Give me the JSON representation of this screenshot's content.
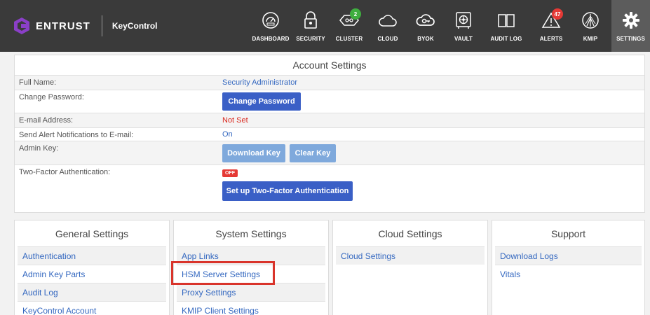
{
  "app": {
    "brand": "ENTRUST",
    "product": "KeyControl"
  },
  "nav": [
    {
      "label": "DASHBOARD",
      "icon": "dashboard-icon"
    },
    {
      "label": "SECURITY",
      "icon": "lock-icon"
    },
    {
      "label": "CLUSTER",
      "icon": "cluster-icon",
      "badge": "2"
    },
    {
      "label": "CLOUD",
      "icon": "cloud-icon"
    },
    {
      "label": "BYOK",
      "icon": "cloud-key-icon"
    },
    {
      "label": "VAULT",
      "icon": "vault-icon"
    },
    {
      "label": "AUDIT LOG",
      "icon": "book-icon"
    },
    {
      "label": "ALERTS",
      "icon": "warning-icon",
      "badge": "47"
    },
    {
      "label": "KMIP",
      "icon": "kmip-icon"
    },
    {
      "label": "SETTINGS",
      "icon": "gear-icon",
      "active": true
    }
  ],
  "account": {
    "title": "Account Settings",
    "full_name_label": "Full Name:",
    "full_name_value": "Security Administrator",
    "change_password_label": "Change Password:",
    "change_password_button": "Change Password",
    "email_label": "E-mail Address:",
    "email_value": "Not Set",
    "alert_label": "Send Alert Notifications to E-mail:",
    "alert_value": "On",
    "admin_key_label": "Admin Key:",
    "download_key_button": "Download Key",
    "clear_key_button": "Clear Key",
    "twofa_label": "Two-Factor Authentication:",
    "twofa_status": "OFF",
    "twofa_button": "Set up Two-Factor Authentication"
  },
  "panels": {
    "general": {
      "title": "General Settings",
      "links": [
        "Authentication",
        "Admin Key Parts",
        "Audit Log",
        "KeyControl Account"
      ]
    },
    "system": {
      "title": "System Settings",
      "links": [
        "App Links",
        "HSM Server Settings",
        "Proxy Settings",
        "KMIP Client Settings"
      ]
    },
    "cloud": {
      "title": "Cloud Settings",
      "links": [
        "Cloud Settings"
      ]
    },
    "support": {
      "title": "Support",
      "links": [
        "Download Logs",
        "Vitals"
      ]
    }
  },
  "colors": {
    "topbar": "#3a3a3a",
    "link": "#3468c0",
    "button": "#3a5fc6",
    "highlight": "#d9342b",
    "alert_badge": "#e53935",
    "cluster_badge": "#3fae3f"
  }
}
